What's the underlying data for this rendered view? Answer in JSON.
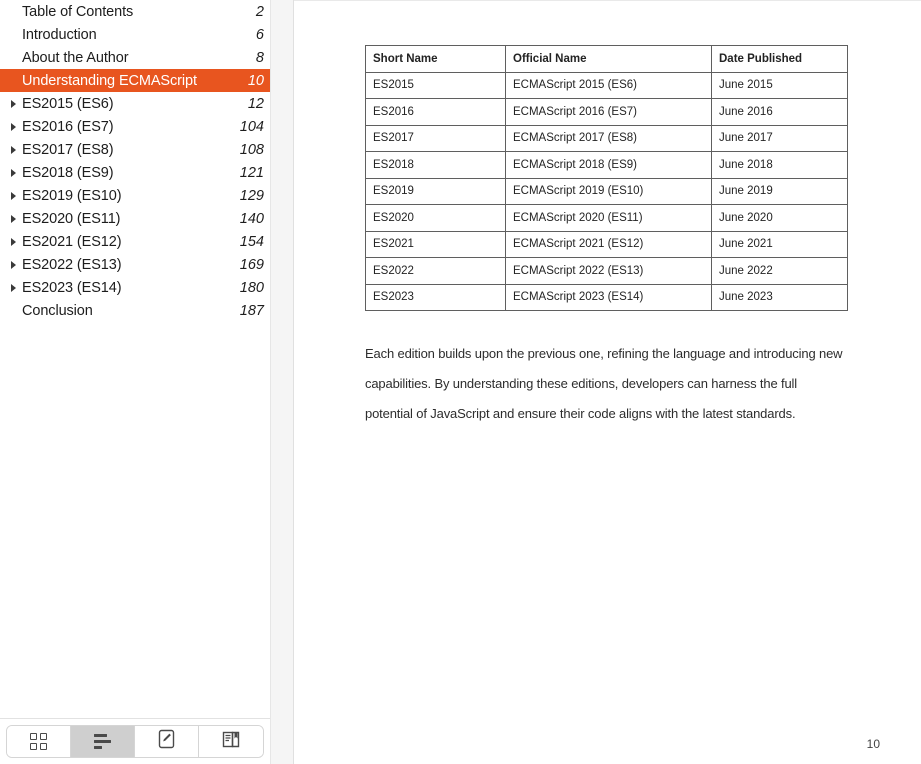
{
  "sidebar": {
    "toc_items": [
      {
        "label": "Table of Contents",
        "page": "2",
        "expandable": false,
        "selected": false
      },
      {
        "label": "Introduction",
        "page": "6",
        "expandable": false,
        "selected": false
      },
      {
        "label": "About the Author",
        "page": "8",
        "expandable": false,
        "selected": false
      },
      {
        "label": "Understanding ECMAScript",
        "page": "10",
        "expandable": false,
        "selected": true
      },
      {
        "label": "ES2015 (ES6)",
        "page": "12",
        "expandable": true,
        "selected": false
      },
      {
        "label": "ES2016 (ES7)",
        "page": "104",
        "expandable": true,
        "selected": false
      },
      {
        "label": "ES2017 (ES8)",
        "page": "108",
        "expandable": true,
        "selected": false
      },
      {
        "label": "ES2018 (ES9)",
        "page": "121",
        "expandable": true,
        "selected": false
      },
      {
        "label": "ES2019 (ES10)",
        "page": "129",
        "expandable": true,
        "selected": false
      },
      {
        "label": "ES2020 (ES11)",
        "page": "140",
        "expandable": true,
        "selected": false
      },
      {
        "label": "ES2021 (ES12)",
        "page": "154",
        "expandable": true,
        "selected": false
      },
      {
        "label": "ES2022 (ES13)",
        "page": "169",
        "expandable": true,
        "selected": false
      },
      {
        "label": "ES2023 (ES14)",
        "page": "180",
        "expandable": true,
        "selected": false
      },
      {
        "label": "Conclusion",
        "page": "187",
        "expandable": false,
        "selected": false
      }
    ],
    "toolbar": {
      "buttons": [
        {
          "icon": "thumbnails-grid-icon",
          "active": false
        },
        {
          "icon": "outline-list-icon",
          "active": true
        },
        {
          "icon": "annotate-pencil-icon",
          "active": false
        },
        {
          "icon": "bookmark-book-icon",
          "active": false
        }
      ]
    },
    "selected_color": "#e8551f"
  },
  "content": {
    "table": {
      "headers": [
        "Short Name",
        "Official Name",
        "Date Published"
      ],
      "rows": [
        [
          "ES2015",
          "ECMAScript 2015 (ES6)",
          "June 2015"
        ],
        [
          "ES2016",
          "ECMAScript 2016 (ES7)",
          "June 2016"
        ],
        [
          "ES2017",
          "ECMAScript 2017 (ES8)",
          "June 2017"
        ],
        [
          "ES2018",
          "ECMAScript 2018 (ES9)",
          "June 2018"
        ],
        [
          "ES2019",
          "ECMAScript 2019 (ES10)",
          "June 2019"
        ],
        [
          "ES2020",
          "ECMAScript 2020 (ES11)",
          "June 2020"
        ],
        [
          "ES2021",
          "ECMAScript 2021 (ES12)",
          "June 2021"
        ],
        [
          "ES2022",
          "ECMAScript 2022 (ES13)",
          "June 2022"
        ],
        [
          "ES2023",
          "ECMAScript 2023 (ES14)",
          "June 2023"
        ]
      ]
    },
    "paragraph": "Each edition builds upon the previous one, refining the language and introducing new capabilities. By understanding these editions, developers can harness the full potential of JavaScript and ensure their code aligns with the latest standards.",
    "page_number": "10"
  }
}
